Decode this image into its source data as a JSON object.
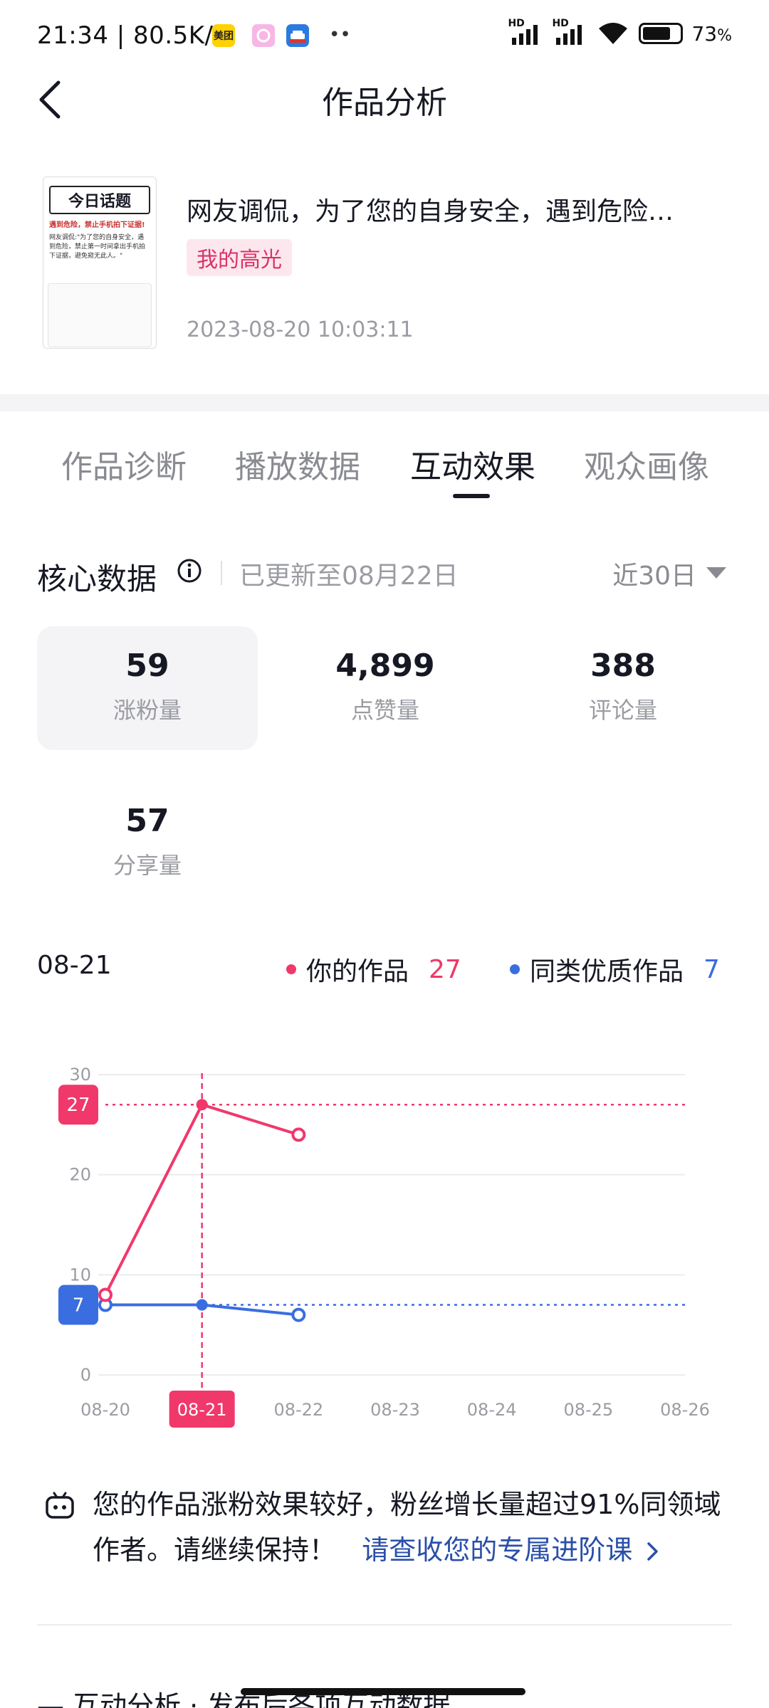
{
  "status_bar": {
    "time": "21:34 | 80.5K/s",
    "app1": "美团",
    "battery": "73",
    "battery_unit": "%",
    "signal1": "HD",
    "signal2": "HD"
  },
  "header": {
    "title": "作品分析"
  },
  "work": {
    "title": "网友调侃，为了您的自身安全，遇到危险…",
    "tag": "我的高光",
    "date": "2023-08-20 10:03:11",
    "thumb_heading": "今日话题",
    "thumb_sub": "遇到危险，禁止手机拍下证据!",
    "thumb_body": "网友调侃:\"为了您的自身安全，遇到危险，禁止第一时间拿出手机拍下证据，避免窥无此人。\""
  },
  "tabs": [
    {
      "label": "作品诊断"
    },
    {
      "label": "播放数据"
    },
    {
      "label": "互动效果"
    },
    {
      "label": "观众画像"
    }
  ],
  "core": {
    "title": "核心数据",
    "updated": "已更新至08月22日",
    "range": "近30日"
  },
  "metrics": [
    {
      "value": "59",
      "label": "涨粉量",
      "selected": true
    },
    {
      "value": "4,899",
      "label": "点赞量",
      "selected": false
    },
    {
      "value": "388",
      "label": "评论量",
      "selected": false
    },
    {
      "value": "57",
      "label": "分享量",
      "selected": false
    }
  ],
  "legend": {
    "date": "08-21",
    "yours_label": "你的作品",
    "yours_value": "27",
    "peer_label": "同类优质作品",
    "peer_value": "7"
  },
  "colors": {
    "yours": "#f0386b",
    "peer": "#3a6ee0",
    "grid": "#ececee"
  },
  "chart_data": {
    "type": "line",
    "x": [
      "08-20",
      "08-21",
      "08-22",
      "08-23",
      "08-24",
      "08-25",
      "08-26"
    ],
    "ylim": [
      0,
      30
    ],
    "yticks": [
      0,
      10,
      20,
      30
    ],
    "selected_x": "08-21",
    "series": [
      {
        "name": "你的作品",
        "values": [
          8,
          27,
          24
        ]
      },
      {
        "name": "同类优质作品",
        "values": [
          7,
          7,
          6
        ]
      }
    ],
    "markers": {
      "yours": "27",
      "peer": "7"
    }
  },
  "insight": {
    "text": "您的作品涨粉效果较好，粉丝增长量超过91%同领域作者。请继续保持！",
    "link": "请查收您的专属进阶课"
  },
  "peek": {
    "text": "— 互动分析 · 发布后各项互动数据"
  }
}
